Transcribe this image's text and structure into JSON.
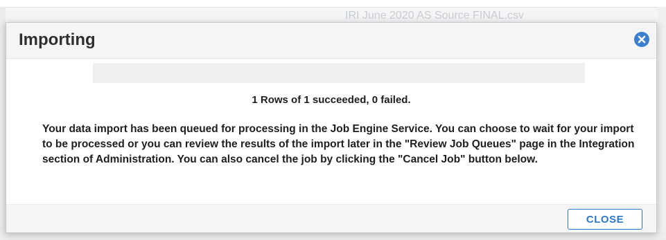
{
  "background": {
    "filename_hint": "IRI June 2020 AS Source FINAL.csv"
  },
  "dialog": {
    "title": "Importing",
    "close_icon": "close-circle-x-icon",
    "progress_percent": 0,
    "summary": "1 Rows of 1 succeeded, 0 failed.",
    "message": "Your data import has been queued for processing in the Job Engine Service. You can choose to wait for your import to be processed or you can review the results of the import later in the \"Review Job Queues\" page in the Integration section of Administration. You can also cancel the job by clicking the \"Cancel Job\" button below.",
    "close_button_label": "CLOSE"
  },
  "colors": {
    "accent": "#2a77c8",
    "close_icon": "#3a7fd0",
    "header_bg": "#f5f5f5",
    "progress_track": "#efefef"
  }
}
